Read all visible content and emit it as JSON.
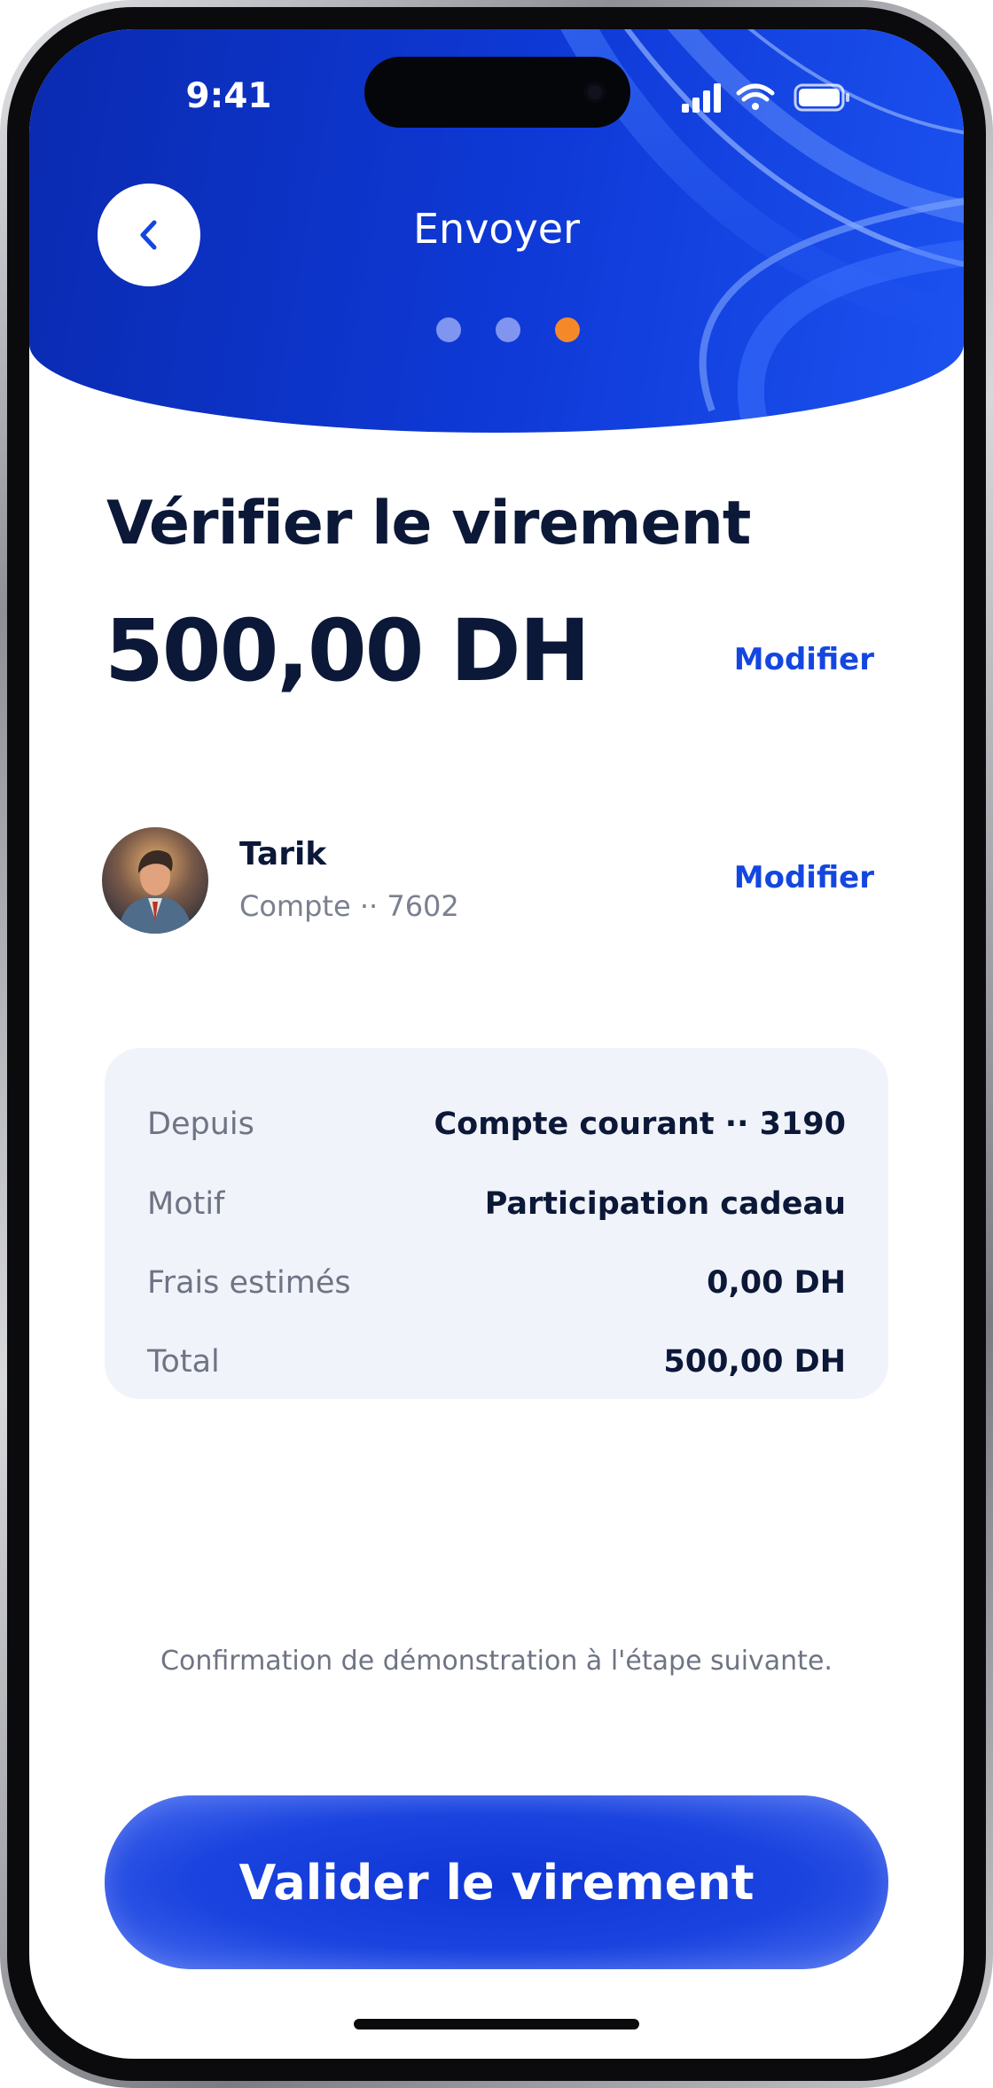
{
  "status_bar": {
    "time": "9:41"
  },
  "header": {
    "title": "Envoyer",
    "steps": {
      "total": 3,
      "current": 3
    }
  },
  "review": {
    "title": "Vérifier le virement",
    "amount": "500,00 DH",
    "amount_edit_label": "Modifier"
  },
  "recipient": {
    "name": "Tarik",
    "account": "Compte ·· 7602",
    "edit_label": "Modifier"
  },
  "summary": {
    "rows": [
      {
        "label": "Depuis",
        "value": "Compte courant ·· 3190"
      },
      {
        "label": "Motif",
        "value": "Participation cadeau"
      },
      {
        "label": "Frais estimés",
        "value": "0,00 DH"
      },
      {
        "label": "Total",
        "value": "500,00 DH"
      }
    ]
  },
  "note": "Confirmation de démonstration à l'étape suivante.",
  "cta_label": "Valider le virement",
  "colors": {
    "brand_blue": "#1446e0",
    "header_blue": "#0f3ad8",
    "active_step": "#f5892a",
    "inactive_step": "#7f95f0",
    "text_dark": "#0c1838"
  }
}
